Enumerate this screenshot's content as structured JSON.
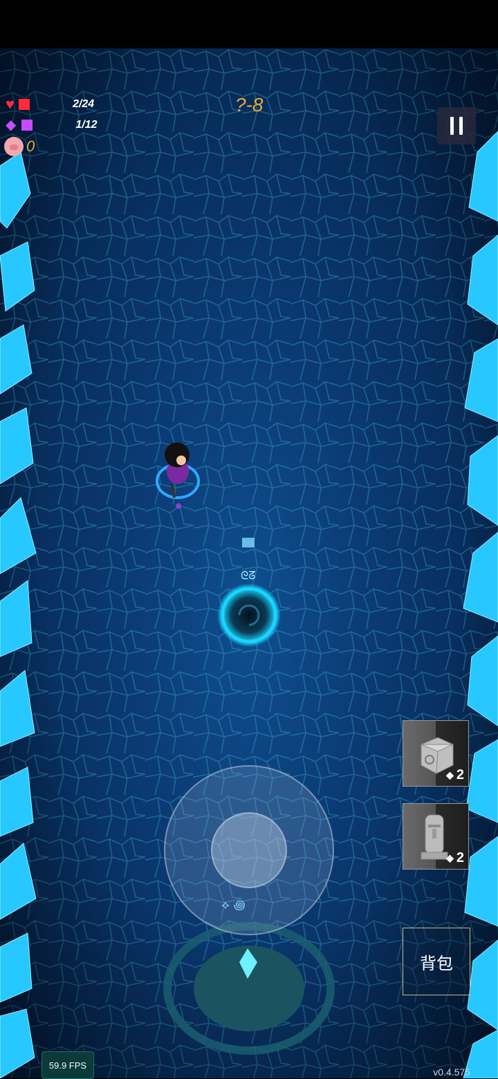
{
  "hud": {
    "hp_text": "2/24",
    "mana_text": "1/12",
    "gold_text": "0",
    "level_text": "?-8"
  },
  "items": [
    {
      "name": "rune-cube",
      "count": "2"
    },
    {
      "name": "moai-statue",
      "count": "2"
    }
  ],
  "bag_label": "背包",
  "fps_text": "59.9 FPS",
  "version_text": "v0.4.575",
  "colors": {
    "heart": "#ff2a3c",
    "mana": "#c44bff",
    "level": "#e8a93a",
    "portal": "#19d6ff",
    "crystal": "#26c8ff"
  }
}
